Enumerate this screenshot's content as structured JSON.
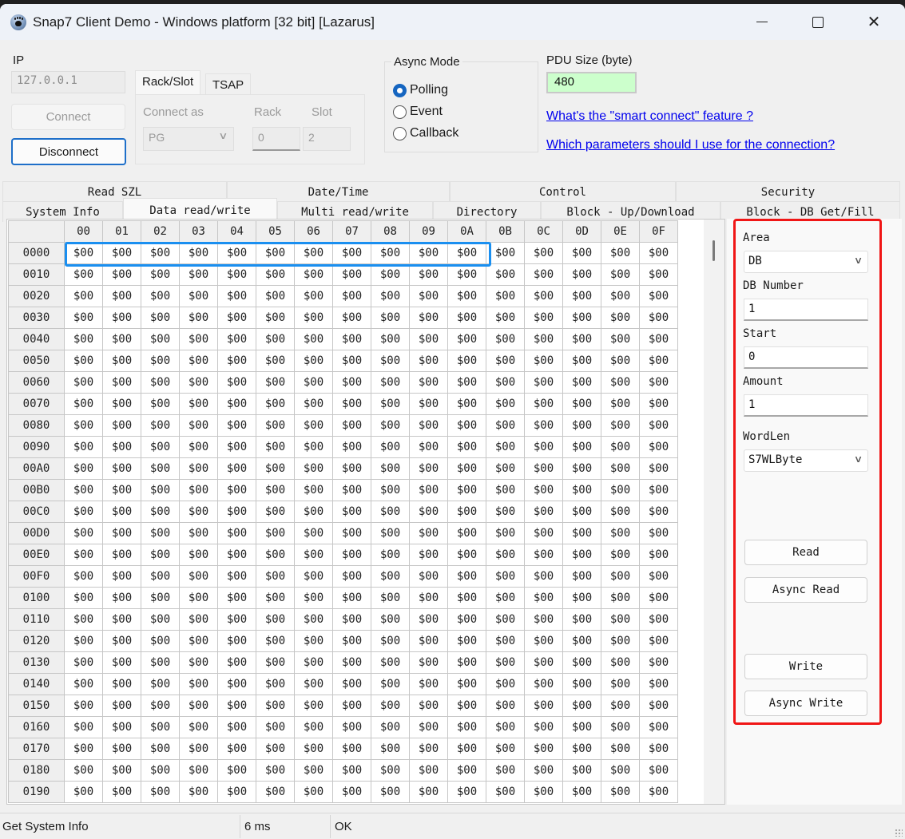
{
  "window": {
    "title": "Snap7 Client Demo - Windows platform [32 bit] [Lazarus]",
    "controls": {
      "minimize": "minimize",
      "maximize": "maximize",
      "close": "close"
    }
  },
  "connection": {
    "ip_label": "IP",
    "ip_value": "127.0.0.1",
    "connect_label": "Connect",
    "disconnect_label": "Disconnect",
    "tabs": [
      {
        "label": "Rack/Slot",
        "active": true
      },
      {
        "label": "TSAP",
        "active": false
      }
    ],
    "connect_as_label": "Connect as",
    "connect_as_value": "PG",
    "rack_label": "Rack",
    "rack_value": "0",
    "slot_label": "Slot",
    "slot_value": "2"
  },
  "async_mode": {
    "title": "Async Mode",
    "options": [
      {
        "label": "Polling",
        "selected": true
      },
      {
        "label": "Event",
        "selected": false
      },
      {
        "label": "Callback",
        "selected": false
      }
    ]
  },
  "pdu": {
    "label": "PDU Size (byte)",
    "value": "480",
    "value_bg": "#ccffcc"
  },
  "links": [
    "What's the \"smart connect\" feature ?",
    "Which parameters should I use for the connection?"
  ],
  "main_tabs": {
    "row1": [
      "Read SZL",
      "Date/Time",
      "Control",
      "Security"
    ],
    "row2": [
      "System Info",
      "Data read/write",
      "Multi read/write",
      "Directory",
      "Block - Up/Download",
      "Block - DB Get/Fill"
    ],
    "active": "Data read/write"
  },
  "grid": {
    "columns": [
      "00",
      "01",
      "02",
      "03",
      "04",
      "05",
      "06",
      "07",
      "08",
      "09",
      "0A",
      "0B",
      "0C",
      "0D",
      "0E",
      "0F"
    ],
    "rows": [
      "0000",
      "0010",
      "0020",
      "0030",
      "0040",
      "0050",
      "0060",
      "0070",
      "0080",
      "0090",
      "00A0",
      "00B0",
      "00C0",
      "00D0",
      "00E0",
      "00F0",
      "0100",
      "0110",
      "0120",
      "0130",
      "0140",
      "0150",
      "0160",
      "0170",
      "0180",
      "0190"
    ],
    "cell_value": "$00",
    "selection_color": "#1a8ff0"
  },
  "params": {
    "area_label": "Area",
    "area_value": "DB",
    "db_number_label": "DB Number",
    "db_number_value": "1",
    "start_label": "Start",
    "start_value": "0",
    "amount_label": "Amount",
    "amount_value": "1",
    "wordlen_label": "WordLen",
    "wordlen_value": "S7WLByte",
    "read_label": "Read",
    "async_read_label": "Async Read",
    "write_label": "Write",
    "async_write_label": "Async Write",
    "highlight_color": "#f01616"
  },
  "status": {
    "operation": "Get System Info",
    "time": "6 ms",
    "result": "OK"
  }
}
